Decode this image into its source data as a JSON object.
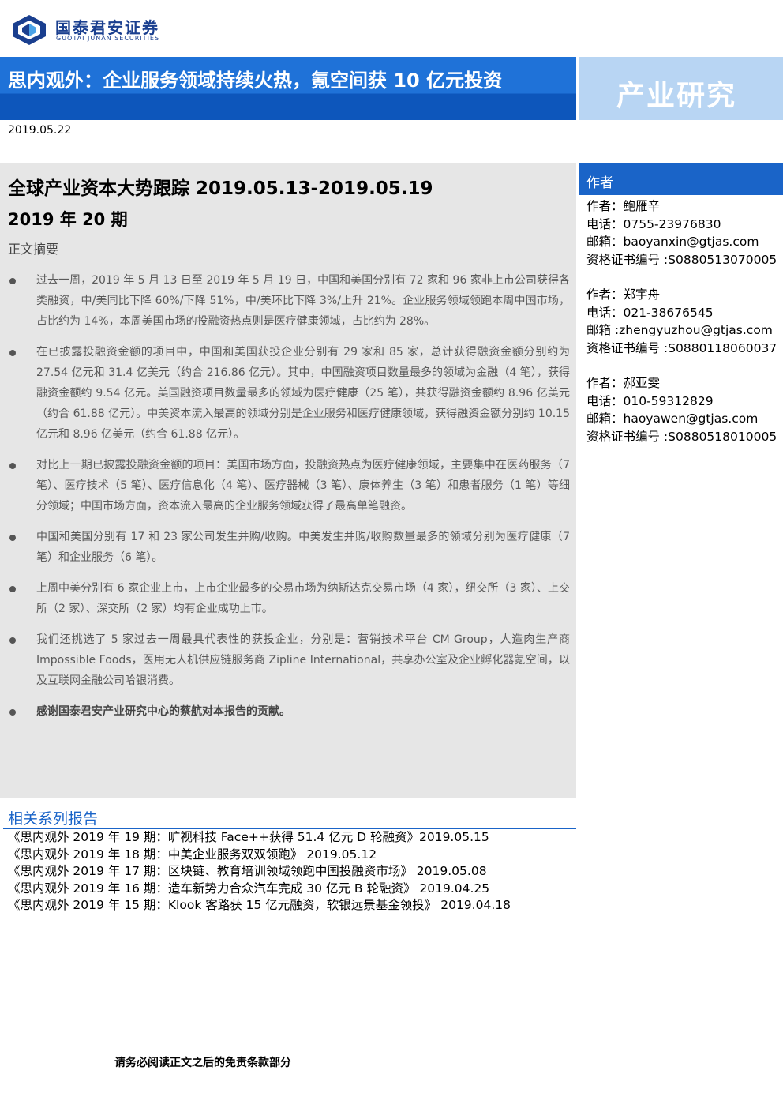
{
  "header": {
    "logo_cn": "国泰君安证券",
    "logo_en": "GUOTAI JUNAN SECURITIES",
    "brand_color": "#1a3f8f",
    "title": "思内观外：企业服务领域持续火热，氪空间获 10 亿元投资",
    "category": "产业研究",
    "date": "2019.05.22"
  },
  "report": {
    "title": "全球产业资本大势跟踪 2019.05.13-2019.05.19",
    "issue": "2019 年  20 期",
    "abstract_label": "正文摘要",
    "bullets": [
      "过去一周，2019 年 5 月 13 日至 2019 年 5 月 19 日，中国和美国分别有 72 家和 96 家非上市公司获得各类融资，中/美同比下降 60%/下降 51%，中/美环比下降 3%/上升 21%。企业服务领域领跑本周中国市场，占比约为 14%，本周美国市场的投融资热点则是医疗健康领域，占比约为 28%。",
      "在已披露投融资金额的项目中，中国和美国获投企业分别有 29 家和 85 家，总计获得融资金额分别约为 27.54 亿元和 31.4 亿美元（约合 216.86 亿元）。其中，中国融资项目数量最多的领域为金融（4 笔），获得融资金额约 9.54 亿元。美国融资项目数量最多的领域为医疗健康（25 笔），共获得融资金额约 8.96 亿美元（约合 61.88 亿元）。中美资本流入最高的领域分别是企业服务和医疗健康领域，获得融资金额分别约 10.15 亿元和 8.96 亿美元（约合 61.88 亿元）。",
      "对比上一期已披露投融资金额的项目：美国市场方面，投融资热点为医疗健康领域，主要集中在医药服务（7 笔）、医疗技术（5 笔）、医疗信息化（4 笔）、医疗器械（3 笔）、康体养生（3 笔）和患者服务（1 笔）等细分领域；中国市场方面，资本流入最高的企业服务领域获得了最高单笔融资。",
      "中国和美国分别有 17 和 23 家公司发生并购/收购。中美发生并购/收购数量最多的领域分别为医疗健康（7 笔）和企业服务（6 笔）。",
      "上周中美分别有 6 家企业上市，上市企业最多的交易市场为纳斯达克交易市场（4 家），纽交所（3 家）、上交所（2 家）、深交所（2 家）均有企业成功上市。",
      "我们还挑选了 5 家过去一周最具代表性的获投企业，分别是：营销技术平台 CM Group，人造肉生产商 Impossible Foods，医用无人机供应链服务商 Zipline International，共享办公室及企业孵化器氪空间，以及互联网金融公司哈银消费。",
      "感谢国泰君安产业研究中心的蔡航对本报告的贡献。"
    ]
  },
  "authors": {
    "heading": "作者",
    "list": [
      {
        "name": "作者：鲍雁辛",
        "phone": "电话：0755-23976830",
        "email": "邮箱：baoyanxin@gtjas.com",
        "cert": "资格证书编号 :S0880513070005"
      },
      {
        "name": "作者：郑宇舟",
        "phone": "电话：021-38676545",
        "email": "邮箱 :zhengyuzhou@gtjas.com",
        "cert": "资格证书编号 :S0880118060037"
      },
      {
        "name": "作者：郝亚雯",
        "phone": "电话：010-59312829",
        "email": "邮箱：haoyawen@gtjas.com",
        "cert": "资格证书编号 :S0880518010005"
      }
    ]
  },
  "related": {
    "title": "相关系列报告",
    "items": [
      "《思内观外 2019 年 19 期：旷视科技 Face++获得 51.4 亿元 D 轮融资》2019.05.15",
      "《思内观外 2019 年 18 期：中美企业服务双双领跑》  2019.05.12",
      "《思内观外 2019 年 17 期：区块链、教育培训领域领跑中国投融资市场》  2019.05.08",
      "《思内观外 2019 年 16 期：造车新势力合众汽车完成 30 亿元 B 轮融资》  2019.04.25",
      "《思内观外 2019 年 15 期：Klook 客路获 15 亿元融资，软银远景基金领投》  2019.04.18"
    ]
  },
  "footer": {
    "disclaimer": "请务必阅读正文之后的免责条款部分"
  }
}
